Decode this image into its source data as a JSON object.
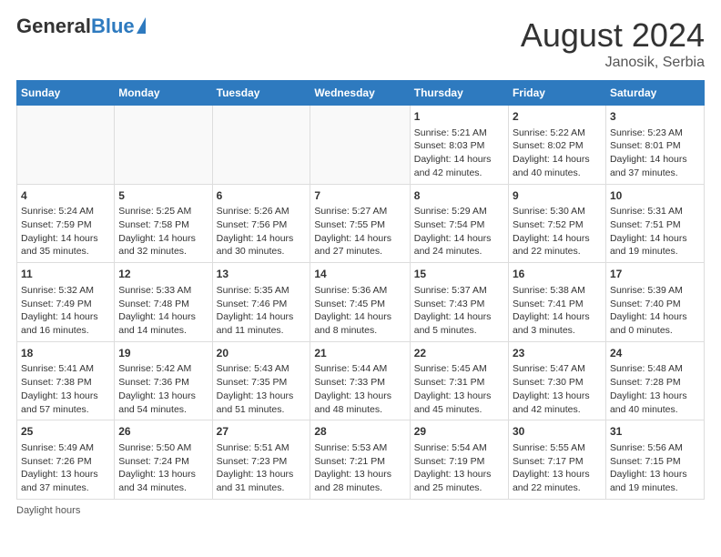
{
  "header": {
    "logo_general": "General",
    "logo_blue": "Blue",
    "title": "August 2024",
    "location": "Janosik, Serbia"
  },
  "footer": {
    "daylight_label": "Daylight hours"
  },
  "weekdays": [
    "Sunday",
    "Monday",
    "Tuesday",
    "Wednesday",
    "Thursday",
    "Friday",
    "Saturday"
  ],
  "weeks": [
    [
      {
        "day": "",
        "info": ""
      },
      {
        "day": "",
        "info": ""
      },
      {
        "day": "",
        "info": ""
      },
      {
        "day": "",
        "info": ""
      },
      {
        "day": "1",
        "info": "Sunrise: 5:21 AM\nSunset: 8:03 PM\nDaylight: 14 hours\nand 42 minutes."
      },
      {
        "day": "2",
        "info": "Sunrise: 5:22 AM\nSunset: 8:02 PM\nDaylight: 14 hours\nand 40 minutes."
      },
      {
        "day": "3",
        "info": "Sunrise: 5:23 AM\nSunset: 8:01 PM\nDaylight: 14 hours\nand 37 minutes."
      }
    ],
    [
      {
        "day": "4",
        "info": "Sunrise: 5:24 AM\nSunset: 7:59 PM\nDaylight: 14 hours\nand 35 minutes."
      },
      {
        "day": "5",
        "info": "Sunrise: 5:25 AM\nSunset: 7:58 PM\nDaylight: 14 hours\nand 32 minutes."
      },
      {
        "day": "6",
        "info": "Sunrise: 5:26 AM\nSunset: 7:56 PM\nDaylight: 14 hours\nand 30 minutes."
      },
      {
        "day": "7",
        "info": "Sunrise: 5:27 AM\nSunset: 7:55 PM\nDaylight: 14 hours\nand 27 minutes."
      },
      {
        "day": "8",
        "info": "Sunrise: 5:29 AM\nSunset: 7:54 PM\nDaylight: 14 hours\nand 24 minutes."
      },
      {
        "day": "9",
        "info": "Sunrise: 5:30 AM\nSunset: 7:52 PM\nDaylight: 14 hours\nand 22 minutes."
      },
      {
        "day": "10",
        "info": "Sunrise: 5:31 AM\nSunset: 7:51 PM\nDaylight: 14 hours\nand 19 minutes."
      }
    ],
    [
      {
        "day": "11",
        "info": "Sunrise: 5:32 AM\nSunset: 7:49 PM\nDaylight: 14 hours\nand 16 minutes."
      },
      {
        "day": "12",
        "info": "Sunrise: 5:33 AM\nSunset: 7:48 PM\nDaylight: 14 hours\nand 14 minutes."
      },
      {
        "day": "13",
        "info": "Sunrise: 5:35 AM\nSunset: 7:46 PM\nDaylight: 14 hours\nand 11 minutes."
      },
      {
        "day": "14",
        "info": "Sunrise: 5:36 AM\nSunset: 7:45 PM\nDaylight: 14 hours\nand 8 minutes."
      },
      {
        "day": "15",
        "info": "Sunrise: 5:37 AM\nSunset: 7:43 PM\nDaylight: 14 hours\nand 5 minutes."
      },
      {
        "day": "16",
        "info": "Sunrise: 5:38 AM\nSunset: 7:41 PM\nDaylight: 14 hours\nand 3 minutes."
      },
      {
        "day": "17",
        "info": "Sunrise: 5:39 AM\nSunset: 7:40 PM\nDaylight: 14 hours\nand 0 minutes."
      }
    ],
    [
      {
        "day": "18",
        "info": "Sunrise: 5:41 AM\nSunset: 7:38 PM\nDaylight: 13 hours\nand 57 minutes."
      },
      {
        "day": "19",
        "info": "Sunrise: 5:42 AM\nSunset: 7:36 PM\nDaylight: 13 hours\nand 54 minutes."
      },
      {
        "day": "20",
        "info": "Sunrise: 5:43 AM\nSunset: 7:35 PM\nDaylight: 13 hours\nand 51 minutes."
      },
      {
        "day": "21",
        "info": "Sunrise: 5:44 AM\nSunset: 7:33 PM\nDaylight: 13 hours\nand 48 minutes."
      },
      {
        "day": "22",
        "info": "Sunrise: 5:45 AM\nSunset: 7:31 PM\nDaylight: 13 hours\nand 45 minutes."
      },
      {
        "day": "23",
        "info": "Sunrise: 5:47 AM\nSunset: 7:30 PM\nDaylight: 13 hours\nand 42 minutes."
      },
      {
        "day": "24",
        "info": "Sunrise: 5:48 AM\nSunset: 7:28 PM\nDaylight: 13 hours\nand 40 minutes."
      }
    ],
    [
      {
        "day": "25",
        "info": "Sunrise: 5:49 AM\nSunset: 7:26 PM\nDaylight: 13 hours\nand 37 minutes."
      },
      {
        "day": "26",
        "info": "Sunrise: 5:50 AM\nSunset: 7:24 PM\nDaylight: 13 hours\nand 34 minutes."
      },
      {
        "day": "27",
        "info": "Sunrise: 5:51 AM\nSunset: 7:23 PM\nDaylight: 13 hours\nand 31 minutes."
      },
      {
        "day": "28",
        "info": "Sunrise: 5:53 AM\nSunset: 7:21 PM\nDaylight: 13 hours\nand 28 minutes."
      },
      {
        "day": "29",
        "info": "Sunrise: 5:54 AM\nSunset: 7:19 PM\nDaylight: 13 hours\nand 25 minutes."
      },
      {
        "day": "30",
        "info": "Sunrise: 5:55 AM\nSunset: 7:17 PM\nDaylight: 13 hours\nand 22 minutes."
      },
      {
        "day": "31",
        "info": "Sunrise: 5:56 AM\nSunset: 7:15 PM\nDaylight: 13 hours\nand 19 minutes."
      }
    ]
  ]
}
